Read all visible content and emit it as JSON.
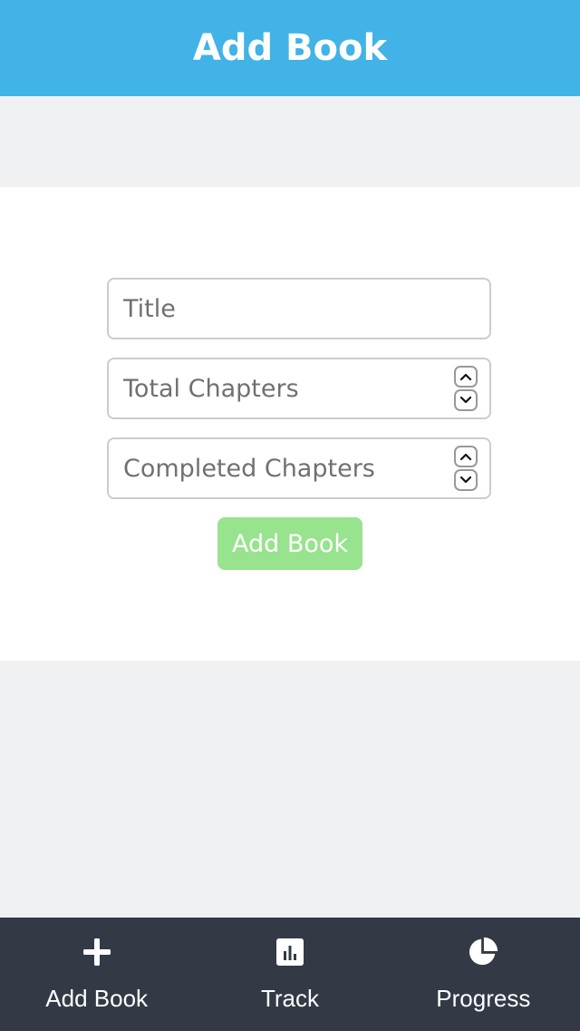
{
  "header": {
    "title": "Add Book"
  },
  "form": {
    "title_placeholder": "Title",
    "title_value": "",
    "total_chapters_placeholder": "Total Chapters",
    "total_chapters_value": "",
    "completed_chapters_placeholder": "Completed Chapters",
    "completed_chapters_value": "",
    "submit_label": "Add Book",
    "submit_color": "#98e38e"
  },
  "nav": {
    "items": [
      {
        "label": "Add Book",
        "icon": "plus-icon"
      },
      {
        "label": "Track",
        "icon": "bar-chart-icon"
      },
      {
        "label": "Progress",
        "icon": "pie-chart-icon"
      }
    ]
  },
  "colors": {
    "header_bg": "#41b3e6",
    "nav_bg": "#333a46",
    "page_bg": "#f0f1f3"
  }
}
